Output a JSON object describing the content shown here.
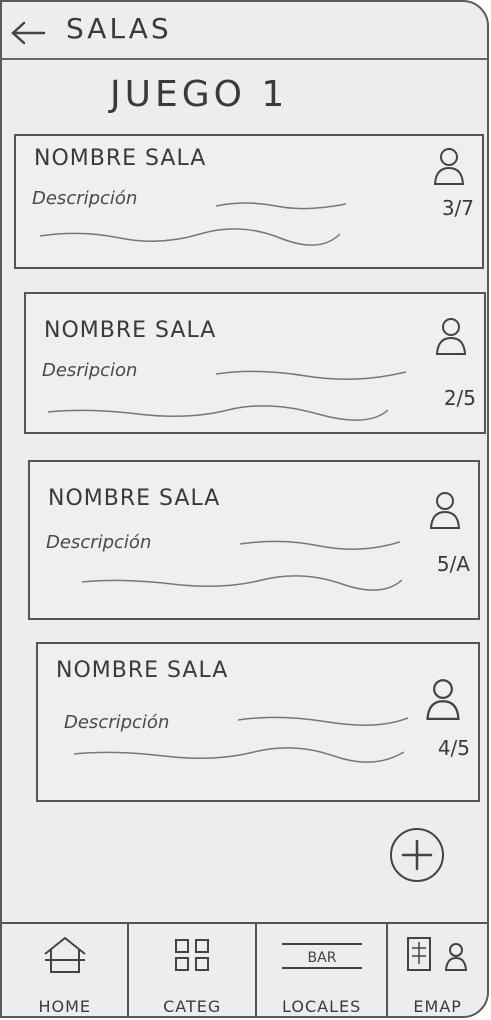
{
  "header": {
    "title": "SALAS",
    "back_icon": "arrow-left-icon"
  },
  "game_title": "JUEGO 1",
  "rooms": [
    {
      "name": "NOMBRE SALA",
      "description": "Descripción",
      "count": "3/7"
    },
    {
      "name": "NOMBRE SALA",
      "description": "Desripcion",
      "count": "2/5"
    },
    {
      "name": "NOMBRE SALA",
      "description": "Descripción",
      "count": "5/A"
    },
    {
      "name": "NOMBRE SALA",
      "description": "Descripción",
      "count": "4/5"
    }
  ],
  "fab": {
    "icon": "plus-icon"
  },
  "bottom_nav": [
    {
      "label": "HOME",
      "icon": "house-icon"
    },
    {
      "label": "CATEG",
      "icon": "grid-icon"
    },
    {
      "label": "LOCALES",
      "icon": "bar-icon"
    },
    {
      "label": "EMAP",
      "icon": "map-icon"
    }
  ]
}
